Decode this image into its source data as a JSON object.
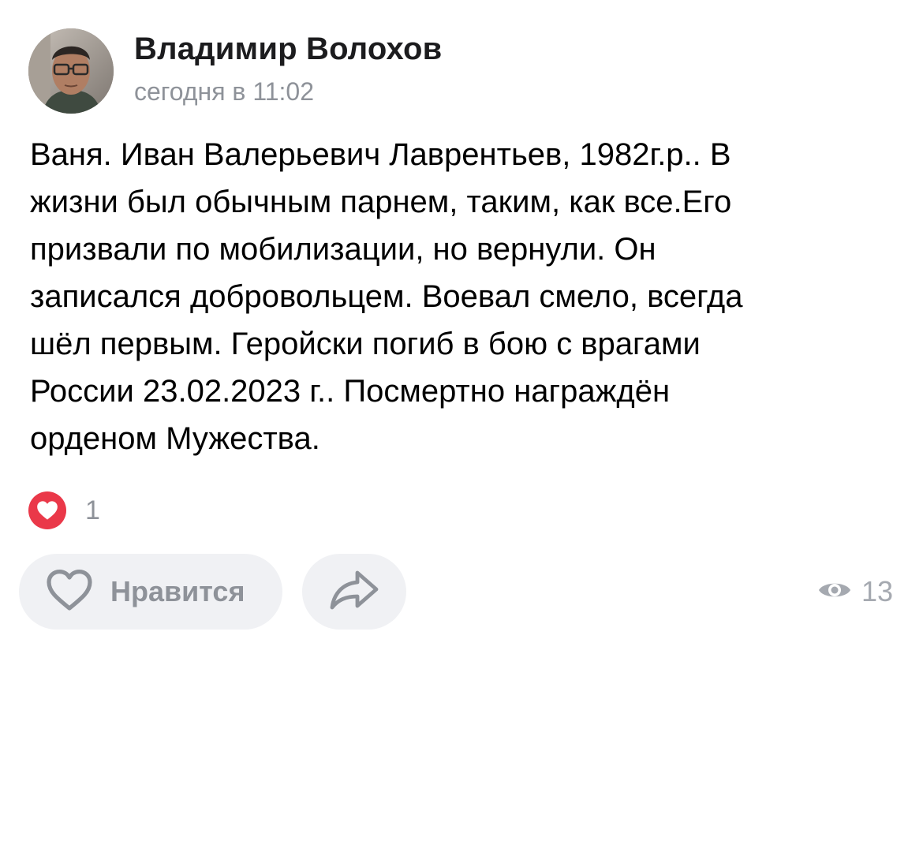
{
  "post": {
    "author": {
      "name": "Владимир Волохов",
      "avatar": "avatar-photo"
    },
    "timestamp": "сегодня в 11:02",
    "text_lines": [
      "Ваня. Иван Валерьевич Лаврентьев, 1982г.р.. В",
      "жизни был обычным парнем, таким, как все.Его",
      "призвали по мобилизации, но вернули. Он",
      "записался добровольцем. Воевал смело, всегда",
      "шёл первым. Геройски погиб в бою с врагами",
      "России 23.02.2023 г.. Посмертно награждён",
      "орденом Мужества."
    ]
  },
  "reactions": {
    "icon": "heart-icon",
    "count": "1"
  },
  "actions": {
    "like_icon": "heart-outline-icon",
    "like_label": "Нравится",
    "share_icon": "share-icon"
  },
  "views": {
    "icon": "eye-icon",
    "count": "13"
  },
  "colors": {
    "reaction_red": "#ea3849",
    "button_bg": "#f0f1f4",
    "secondary_text": "#8e9299",
    "muted_icon": "#a5a9b0"
  }
}
